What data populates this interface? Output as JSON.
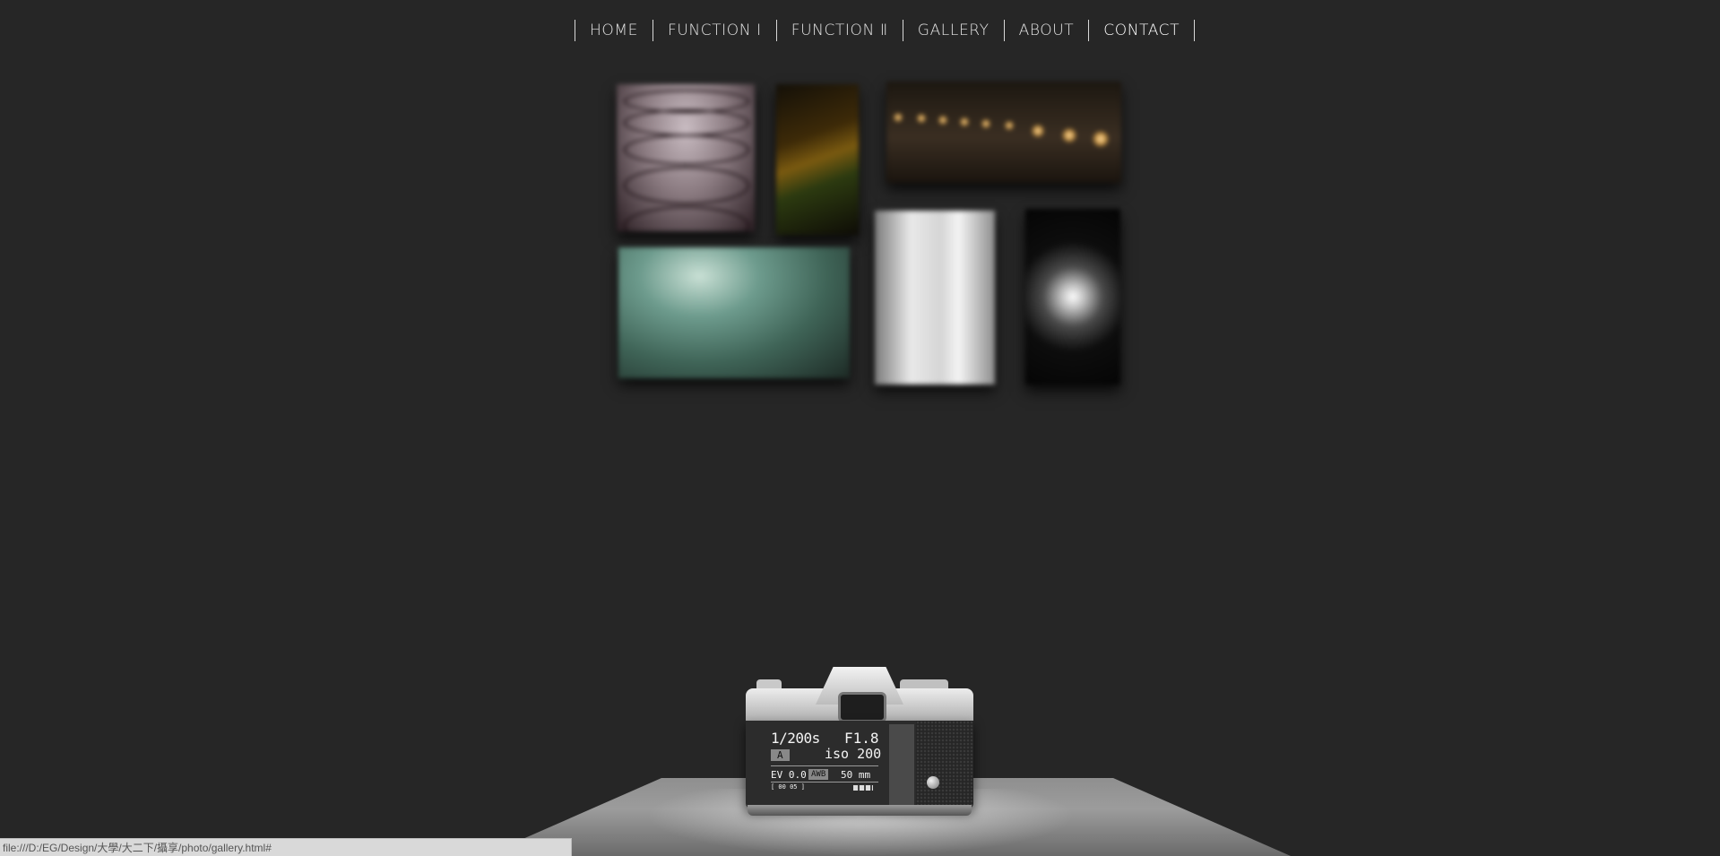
{
  "nav": {
    "items": [
      {
        "label": "HOME"
      },
      {
        "label": "FUNCTION Ⅰ"
      },
      {
        "label": "FUNCTION Ⅱ"
      },
      {
        "label": "GALLERY"
      },
      {
        "label": "ABOUT"
      },
      {
        "label": "CONTACT"
      }
    ]
  },
  "gallery": {
    "photos": [
      {
        "subject": "wine-glasses"
      },
      {
        "subject": "light-trails"
      },
      {
        "subject": "night-pier-lights"
      },
      {
        "subject": "sky-reflection"
      },
      {
        "subject": "waterfall"
      },
      {
        "subject": "glowing-glass"
      }
    ]
  },
  "camera_screen": {
    "shutter": "1/200s",
    "aperture": "F1.8",
    "mode": "A",
    "iso": "iso 200",
    "ev": "EV 0.0",
    "awb": "AWB",
    "focal": "50 mm",
    "frames": "[ 00 05 ]"
  },
  "statusbar": {
    "url": "file:///D:/EG/Design/大學/大二下/攝享/photo/gallery.html#"
  },
  "colors": {
    "background": "#262626",
    "nav_text": "#e4e4e4",
    "statusbar_bg": "#d9d9d9"
  }
}
